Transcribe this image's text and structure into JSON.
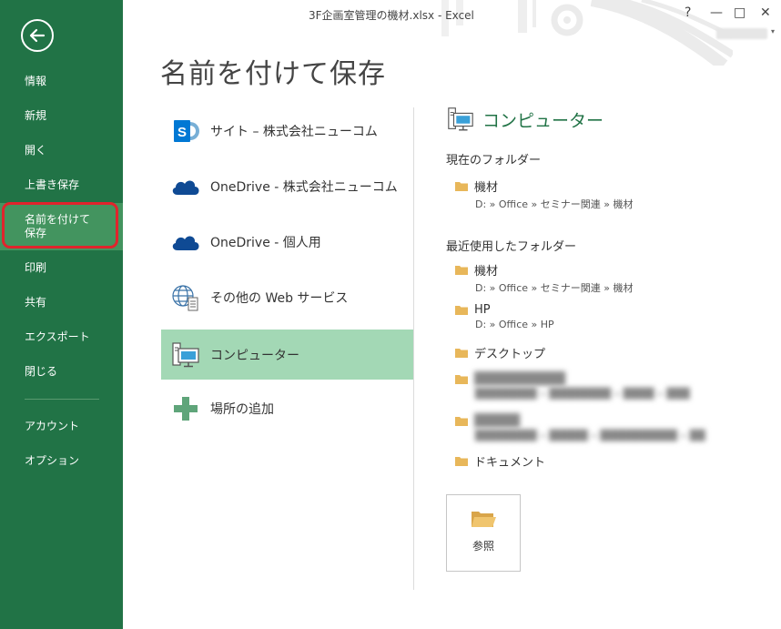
{
  "window": {
    "title": "3F企画室管理の機材.xlsx - Excel",
    "help": "?",
    "minimize": "—",
    "restore": "□",
    "close": "✕",
    "user_caret": "▾"
  },
  "sidebar": {
    "items": [
      {
        "label": "情報"
      },
      {
        "label": "新規"
      },
      {
        "label": "開く"
      },
      {
        "label": "上書き保存"
      },
      {
        "label": "名前を付けて\n保存"
      },
      {
        "label": "印刷"
      },
      {
        "label": "共有"
      },
      {
        "label": "エクスポート"
      },
      {
        "label": "閉じる"
      },
      {
        "label": "アカウント"
      },
      {
        "label": "オプション"
      }
    ]
  },
  "page": {
    "title": "名前を付けて保存"
  },
  "places": [
    {
      "label": "サイト – 株式会社ニューコム",
      "icon": "sharepoint-icon"
    },
    {
      "label": "OneDrive - 株式会社ニューコム",
      "icon": "cloud-icon"
    },
    {
      "label": "OneDrive - 個人用",
      "icon": "cloud-icon"
    },
    {
      "label": "その他の Web サービス",
      "icon": "web-services-icon"
    },
    {
      "label": "コンピューター",
      "icon": "computer-icon"
    },
    {
      "label": "場所の追加",
      "icon": "plus-icon"
    }
  ],
  "right": {
    "header": "コンピューター",
    "current_title": "現在のフォルダー",
    "recent_title": "最近使用したフォルダー",
    "current_folder": {
      "name": "機材",
      "path": "D: » Office » セミナー関連 » 機材"
    },
    "recent": [
      {
        "name": "機材",
        "path": "D: » Office » セミナー関連 » 機材"
      },
      {
        "name": "HP",
        "path": "D: » Office » HP"
      },
      {
        "name": "デスクトップ",
        "path": ""
      },
      {
        "name": "██████████",
        "path": "████████ » ████████ » ████ » ███"
      },
      {
        "name": "█████",
        "path": "████████ » █████ » ██████████ » ██"
      },
      {
        "name": "ドキュメント",
        "path": ""
      }
    ],
    "browse_label": "参照"
  },
  "colors": {
    "accent": "#217346",
    "selected_place": "#a3d8b5",
    "active_side": "#43945f",
    "highlight_ring": "#e0242c",
    "folder": "#e8b75a"
  }
}
